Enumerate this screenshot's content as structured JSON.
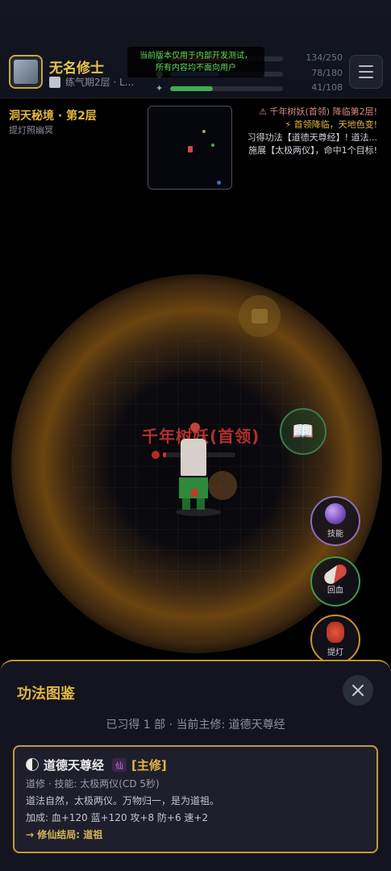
{
  "player": {
    "name": "无名修士",
    "realm": "练气期2层 · L..."
  },
  "stats": {
    "hp": {
      "text": "134/250",
      "fraction": 0.536,
      "color": "#c94a4a"
    },
    "mp": {
      "text": "78/180",
      "fraction": 0.433,
      "color": "#4a6fc9"
    },
    "exp": {
      "text": "41/108",
      "fraction": 0.38,
      "color": "#3fae4e"
    }
  },
  "banner": {
    "line1": "当前版本仅用于内部开发测试，",
    "line2": "所有内容均不面向用户"
  },
  "dungeon": {
    "name": "洞天秘境 · 第2层",
    "subtitle": "提灯照幽冥"
  },
  "log": [
    "⚠ 千年树妖(首领) 降临第2层!",
    "⚡ 首领降临，天地色变!",
    "习得功法【道德天尊经】! 道法...",
    "施展【太极两仪】，命中1个目标!"
  ],
  "boss": {
    "name": "千年树妖(首领)",
    "hp_fraction": 0.04
  },
  "actions": {
    "skill": "技能",
    "heal": "回血",
    "lamp": "提灯"
  },
  "panel": {
    "title": "功法图鉴",
    "summary": "已习得 1 部 · 当前主修: 道德天尊经",
    "technique": {
      "name": "道德天尊经",
      "tier": "仙",
      "tag": "[主修]",
      "school": "道修 · 技能: 太极两仪(CD 5秒)",
      "description": "道法自然，太极两仪。万物归一，是为道祖。",
      "bonus": "加成: 血+120 蓝+120 攻+8 防+6 速+2",
      "ending": "→ 修仙结局: 道祖"
    }
  },
  "icons": {
    "menu": "hamburger-icon",
    "close": "close-icon",
    "technique": "yin-yang-icon"
  }
}
